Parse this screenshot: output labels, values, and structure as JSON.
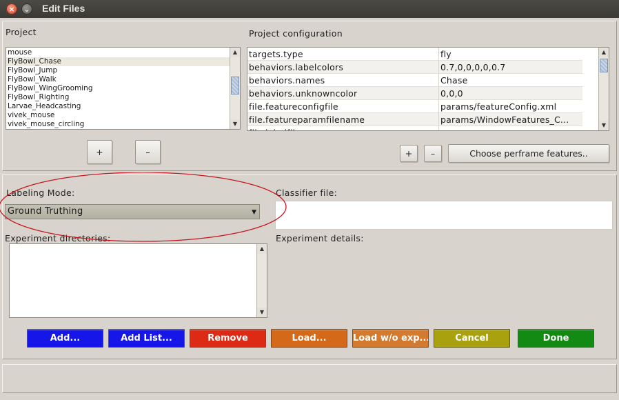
{
  "window": {
    "title": "Edit Files",
    "close_glyph": "×",
    "min_glyph": "⌄"
  },
  "project": {
    "label": "Project",
    "items": [
      "mouse",
      "FlyBowl_Chase",
      "FlyBowl_Jump",
      "FlyBowl_Walk",
      "FlyBowl_WingGrooming",
      "FlyBowl_Righting",
      "Larvae_Headcasting",
      "vivek_mouse",
      "vivek_mouse_circling"
    ],
    "selected_index": 1,
    "add_label": "+",
    "remove_label": "–"
  },
  "config": {
    "label": "Project configuration",
    "rows": [
      {
        "key": "targets.type",
        "value": "fly"
      },
      {
        "key": "behaviors.labelcolors",
        "value": "0.7,0,0,0,0,0.7"
      },
      {
        "key": "behaviors.names",
        "value": "Chase"
      },
      {
        "key": "behaviors.unknowncolor",
        "value": "0,0,0"
      },
      {
        "key": "file.featureconfigfile",
        "value": "params/featureConfig.xml"
      },
      {
        "key": "file.featureparamfilename",
        "value": "params/WindowFeatures_C..."
      },
      {
        "key": "file.labelfile",
        "value": "..."
      }
    ],
    "add_label": "+",
    "remove_label": "–",
    "perframe_label": "Choose perframe features.."
  },
  "labeling": {
    "label": "Labeling Mode:",
    "selected": "Ground Truthing"
  },
  "classifier": {
    "label": "Classifier file:",
    "value": ""
  },
  "experiments": {
    "label": "Experiment directories:",
    "details_label": "Experiment details:"
  },
  "actions": {
    "add": "Add...",
    "add_list": "Add List...",
    "remove": "Remove",
    "load": "Load...",
    "load_wo_exp": "Load w/o exp...",
    "cancel": "Cancel",
    "done": "Done"
  },
  "colors": {
    "add": "#1616e8",
    "add_list": "#1616e8",
    "remove": "#dd2a14",
    "load": "#d4691a",
    "load_wo_exp": "#d47a2e",
    "cancel": "#a9a20e",
    "done": "#138a13",
    "annotation": "#c8141e"
  }
}
